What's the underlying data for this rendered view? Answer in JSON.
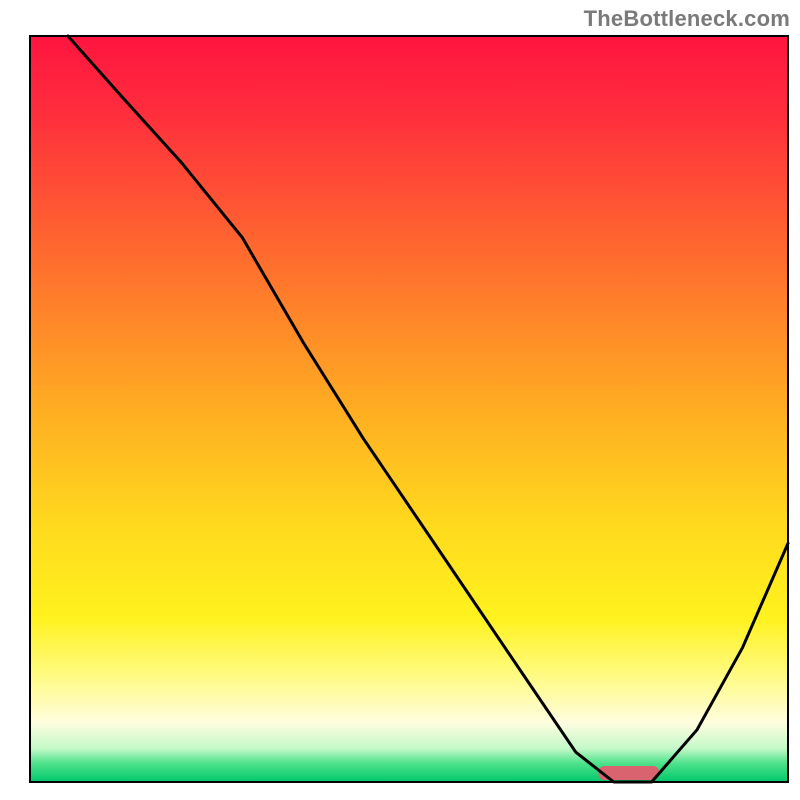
{
  "watermark": "TheBottleneck.com",
  "chart_data": {
    "type": "line",
    "title": "",
    "xlabel": "",
    "ylabel": "",
    "xlim": [
      0,
      100
    ],
    "ylim": [
      0,
      100
    ],
    "background_gradient": {
      "orientation": "vertical",
      "stops": [
        {
          "offset": 0.0,
          "color": "#ff143f"
        },
        {
          "offset": 0.1,
          "color": "#ff2d3d"
        },
        {
          "offset": 0.3,
          "color": "#ff6d2e"
        },
        {
          "offset": 0.5,
          "color": "#ffad22"
        },
        {
          "offset": 0.65,
          "color": "#ffd81e"
        },
        {
          "offset": 0.78,
          "color": "#fff21e"
        },
        {
          "offset": 0.86,
          "color": "#fffb86"
        },
        {
          "offset": 0.92,
          "color": "#fffde0"
        },
        {
          "offset": 0.955,
          "color": "#c4f9c9"
        },
        {
          "offset": 0.975,
          "color": "#4ee28b"
        },
        {
          "offset": 1.0,
          "color": "#00c86a"
        }
      ]
    },
    "series": [
      {
        "name": "bottleneck-curve",
        "stroke": "#000000",
        "x": [
          5,
          12,
          20,
          28,
          36,
          44,
          52,
          60,
          68,
          72,
          77,
          82,
          88,
          94,
          100
        ],
        "y": [
          100,
          92,
          83,
          73,
          59,
          46,
          34,
          22,
          10,
          4,
          0,
          0,
          7,
          18,
          32
        ]
      }
    ],
    "marker": {
      "name": "sweet-spot",
      "x_center": 79,
      "x_halfwidth": 4,
      "color": "#d9636e"
    },
    "frame": {
      "color": "#000000",
      "width": 2
    }
  }
}
